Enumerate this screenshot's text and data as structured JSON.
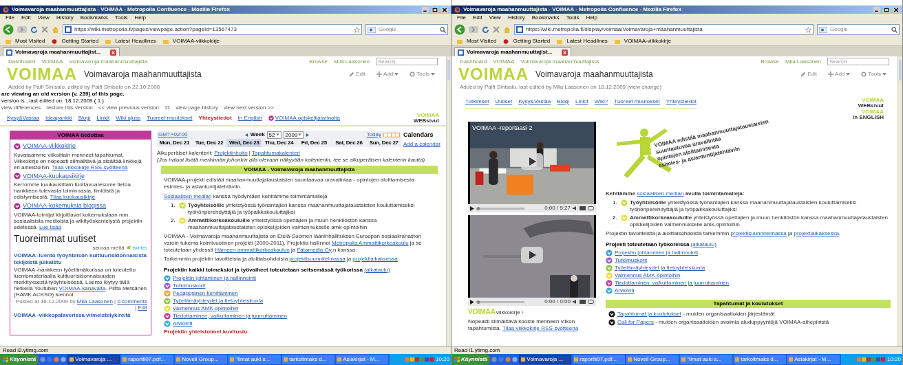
{
  "windows": [
    {
      "title": "Voimavaroja maahanmuuttajista - VOIMAA - Metropolia Confluence - Mozilla Firefox",
      "menu": [
        "File",
        "Edit",
        "View",
        "History",
        "Bookmarks",
        "Tools",
        "Help"
      ],
      "url": "https://wiki.metropolia.fi/pages/viewpage.action?pageId=13567473",
      "search_placeholder": "Google",
      "bookmarks": [
        "Most Visited",
        "Getting Started",
        "Latest Headlines",
        "VOIMAA-viikkokirje"
      ],
      "tab": "Voimavaroja maahanmuuttajist...",
      "breadcrumbs": [
        "Dashboard",
        "VOIMAA",
        "Voimavaroja maahanmuuttajista"
      ],
      "user_links": [
        "Browse",
        "Mila Laasonen"
      ],
      "site_search_placeholder": "Search",
      "logo": "VOIMAA",
      "page_title": "Voimavaroja maahanmuuttajista",
      "actions": [
        "Edit",
        "Add",
        "Tools"
      ],
      "byline": "Added by Paifi Sinisalo, edited by Paifi Sinisalo on 22.10.2008",
      "page": {
        "kind": "calendar_view",
        "version_notice": {
          "heading": "are viewing an old version (v. 259) of this page.",
          "detail": "version is , last edited on: 18.12.2009 ( 1 )",
          "links": [
            "view differences",
            "restore this version",
            "<< view previous version",
            "11",
            "view page history",
            "view next version >>"
          ]
        },
        "nav": [
          {
            "label": "Kysy&Vastaa",
            "selected": false
          },
          {
            "label": "Ideapankki",
            "selected": false
          },
          {
            "label": "Blogi",
            "selected": false
          },
          {
            "label": "Linkit",
            "selected": false
          },
          {
            "label": "Wiki ajuss",
            "selected": false
          },
          {
            "label": "Tuoreet muutokset",
            "selected": false
          },
          {
            "label": "Yhteystiedot",
            "selected": true
          },
          {
            "label": "In English",
            "selected": false
          },
          {
            "label": "VOIMAA opiskelijatarinoita",
            "selected": false,
            "color": "#b02a8a"
          }
        ],
        "corner_logos": [
          [
            "VOIMAA",
            "WEBsivut"
          ]
        ],
        "sidebar": {
          "title": "VOIMAA tiedottaa",
          "items": [
            {
              "title": "VOIMAA-viikkokirje",
              "color": "#b02a8a",
              "text": [
                {
                  "kind": "text",
                  "text": "Kuvataamme viikoittain menneet tapahtumat. Viikkokirje on nopeasti silmäiltävä ja sisältää linkkejä eri aineistoihin. "
                },
                {
                  "kind": "link",
                  "text": "Tilaa viikkokirje RSS-syötteenä"
                }
              ]
            },
            {
              "title": "VOIMAA-kuukausikirje",
              "color": "#b02a8a",
              "text": [
                {
                  "kind": "text",
                  "text": "Kerromme kuukausittain tuottavuaresome tietoa hankkeen tulevasta toiminnasta, ilmiöistä ja edistymisestä. "
                },
                {
                  "kind": "link",
                  "text": "Tilaa kuukausikirje"
                }
              ]
            },
            {
              "title": "VOIMAA-kokemuksia blogissa",
              "color": "#b02a8a",
              "text": [
                {
                  "kind": "text",
                  "text": "VOIMAA-toimijat kirjoittavat kokemuksiaan mm. sosiaalisista medioista ja wikityöskentelystä projektin edetessä. "
                },
                {
                  "kind": "link",
                  "text": "Lue lisää"
                }
              ]
            }
          ]
        },
        "news": {
          "heading": "Tuoreimmat uutiset",
          "follow": "seuraa meitä",
          "twitter": "twitter",
          "items": [
            {
              "title": "VOIMAA -luento työyhteisön kulttuurisidonnaisista tekijöistä julkaistu",
              "text": [
                {
                  "kind": "text",
                  "text": "VOIMAA -hankkeen työelämäkorissa on toteutettu luentomateriaalia kulttuurisidonnaisuuden merkityksestä työyhteisössä. Luento löytyy tällä hetkellä Youtuben "
                },
                {
                  "kind": "link",
                  "text": "VOIMAA-kanavalta"
                },
                {
                  "kind": "text",
                  "text": ". Piitta Metsänen (HAMK ACKSO) luennoi."
                }
              ],
              "meta": [
                {
                  "kind": "text",
                  "text": "Posted at 16.12.2009 by "
                },
                {
                  "kind": "link",
                  "text": "Mila Laasonen"
                },
                {
                  "kind": "text",
                  "text": " | "
                },
                {
                  "kind": "link",
                  "text": "0 comments"
                },
                {
                  "kind": "text",
                  "text": " | "
                },
                {
                  "kind": "link",
                  "text": "Edit"
                }
              ]
            },
            {
              "title": "VOIMAA -viikkopalaverissa viimeistelykireitä"
            }
          ]
        },
        "calendar": {
          "timezone": "GMT+02:00",
          "week_label": "Week",
          "week": "52",
          "year": "2009",
          "today": "Today",
          "days": [
            {
              "label": "Mon, Dec 21",
              "selected": false
            },
            {
              "label": "Tue, Dec 22",
              "selected": false
            },
            {
              "label": "Wed, Dec 23",
              "selected": true
            },
            {
              "label": "Thu, Dec 24",
              "selected": false
            },
            {
              "label": "Fri, Dec 25",
              "selected": false
            },
            {
              "label": "Sat, Dec 26",
              "selected": false
            },
            {
              "label": "Sun, Dec 27",
              "selected": false
            }
          ],
          "side_title": "Calendars",
          "add": "Add a calendar",
          "origins": [
            {
              "kind": "text",
              "text": "Alkuperäiset kalenterit: "
            },
            {
              "kind": "link",
              "text": "Projektinhoito"
            },
            {
              "kind": "text",
              "text": " | "
            },
            {
              "kind": "link",
              "text": "Tapahtumakalenteri"
            }
          ],
          "note": "(Jos haluat lisätä merkinnän johonkin alla olevaan näkyvään kalenteriin, tee se alkuperäisen kalenterin kautta)"
        },
        "content": {
          "banner": "VOIMAA - Voimavaroja maahanmuuttajista",
          "paragraphs_before": [
            [
              {
                "kind": "text",
                "text": "VOIMAA-projekti edistää maahanmuuttajataustaisten suuntaavaa uravalintaa - opintojen aloittamisesta esimies- ja asiantuntijatehtäviin."
              }
            ],
            [
              {
                "kind": "link",
                "text": "Sosiaalisen median"
              },
              {
                "kind": "text",
                "text": " kanssa hyödyntäen kehitämme toimintamalleja"
              }
            ]
          ],
          "steps": [
            {
              "number": "1.",
              "color": "#c8dc3c",
              "text": [
                {
                  "kind": "bold",
                  "text": "Työyhteisöille"
                },
                {
                  "kind": "text",
                  "text": " yhteistyössä työnantajien kanssa maahanmuuttajataustaisten kouluttamiseksi työhönperehdyttäjiä ja työpaikkakouluttajiksi"
                }
              ]
            },
            {
              "number": "2.",
              "color": "#e6e23a",
              "text": [
                {
                  "kind": "bold",
                  "text": "Ammattikorkeakouluille"
                },
                {
                  "kind": "text",
                  "text": " yhteistyössä opettajien ja muun henkilöstön kanssa maahanmuuttajataustaisten opiskelijoiden valmennukselle amk-opintoihin"
                }
              ]
            }
          ],
          "paragraphs_after": [
            [
              {
                "kind": "text",
                "text": "VOIMAA - Voimavaroja maahanmuuttajista on Etelä-Suomen lääninhallituksen Euroopan sosiaalirahaston varoin tukema kolmivuotinen projekti (2009-2011). Projektia hallinnoi "
              },
              {
                "kind": "link",
                "text": "Metropolia Ammattikorkeakoulu"
              },
              {
                "kind": "text",
                "text": " ja se toteutetaan yhdessä "
              },
              {
                "kind": "link",
                "text": "Hämeen ammattikorkeakoulun"
              },
              {
                "kind": "text",
                "text": " ja "
              },
              {
                "kind": "link",
                "text": "Fatamedia Oy"
              },
              {
                "kind": "text",
                "text": ":n kanssa."
              }
            ],
            [
              {
                "kind": "text",
                "text": "Tarkemmin projektin tavoitteista ja aloittaisohdoista "
              },
              {
                "kind": "link",
                "text": "projektisuunnitelmassa"
              },
              {
                "kind": "text",
                "text": " ja "
              },
              {
                "kind": "link",
                "text": "projektiaikaksessa"
              },
              {
                "kind": "text",
                "text": "."
              }
            ]
          ],
          "work_heading": [
            {
              "kind": "bold",
              "text": "Projektin kaikki toimeksiot ja työvaiheet toteutetaan seitsemässä työkorissa "
            },
            {
              "kind": "link",
              "text": "(aikataulu)"
            }
          ],
          "baskets": [
            {
              "label": "Projektin johtaminen ja hallinnointi",
              "color": "#3aa0d8"
            },
            {
              "label": "Tutkimuskorit",
              "color": "#9a5ad0"
            },
            {
              "label": "Pedagoginen kehittäminen",
              "color": "#e8a23a"
            },
            {
              "label": "Työelämäyhteydet ja tietoyhteiskunta",
              "color": "#8cc63e"
            },
            {
              "label": "Valmennus AMK-opintoihin",
              "color": "#e6e23a"
            },
            {
              "label": "Tiedottaminen, vaikuttaminen ja juurruttaminen",
              "color": "#c03a9a"
            },
            {
              "label": "Arviointi",
              "color": "#3aaed0"
            }
          ],
          "footer_heading": "Projektin yhteistoimet kuvitustu"
        }
      },
      "status": "Read i2.ytimg.com",
      "taskbar": {
        "start": "Käynnistä",
        "tasks": [
          {
            "label": "Voimavaroja ...",
            "selected": true
          },
          {
            "label": "raportti07.pdf...",
            "selected": false
          },
          {
            "label": "Novell Group...",
            "selected": false
          },
          {
            "label": "\"Ilmat auki s...",
            "selected": false
          },
          {
            "label": "tarkoitmaks d...",
            "selected": false
          },
          {
            "label": "Asiakirjat - M...",
            "selected": false
          }
        ],
        "clock": "10:20"
      }
    },
    {
      "title": "Voimavaroja maahanmuuttajista - VOIMAA - Metropolia Confluence - Mozilla Firefox",
      "menu": [
        "File",
        "Edit",
        "View",
        "History",
        "Bookmarks",
        "Tools",
        "Help"
      ],
      "url": "https://wiki.metropolia.fi/display/voimaa/Voimavaroja+maahanmuuttajista",
      "search_placeholder": "Google",
      "bookmarks": [
        "Most Visited",
        "Getting Started",
        "Latest Headlines",
        "VOIMAA-viikkokirje"
      ],
      "tab": "Voimavaroja maahanmuuttajist...",
      "breadcrumbs": [
        "Dashboard",
        "VOIMAA",
        "Voimavaroja maahanmuuttajista"
      ],
      "user_links": [
        "Browse",
        "Mila Laasonen"
      ],
      "site_search_placeholder": "Search",
      "logo": "VOIMAA",
      "page_title": "Voimavaroja maahanmuuttajista",
      "actions": [
        "Edit",
        "Add",
        "Tools"
      ],
      "byline": "Added by Paifi Sinisalo, last edited by Mila Laasonen on 18.12.2009 (view change)",
      "page": {
        "kind": "home_view",
        "nav": [
          {
            "label": "Tutkimset",
            "selected": false
          },
          {
            "label": "Uutiset",
            "selected": false
          },
          {
            "label": "Kysy&Vastaa",
            "selected": false
          },
          {
            "label": "Blogi",
            "selected": false
          },
          {
            "label": "Linkit",
            "selected": false
          },
          {
            "label": "Wiki?",
            "selected": false
          },
          {
            "label": "Tuoreet muutokset",
            "selected": false
          },
          {
            "label": "Yhteystiedot",
            "selected": false
          }
        ],
        "corner_logos": [
          [
            "VOIMAA",
            "WEBsivut"
          ],
          [
            "VOIMAA",
            "in ENGLISH"
          ]
        ],
        "videos": [
          {
            "title": "VOIMAA -reportaasi 2",
            "time": "0:00 / 5:27"
          },
          {
            "time": "0:00 / 0:00"
          }
        ],
        "newsletter": {
          "logo": "VOIMAA",
          "label": "viikkokirje ›",
          "text": [
            {
              "kind": "text",
              "text": "Nopeasti silmäiltävä kooste menneen viikon tapahtumista. "
            },
            {
              "kind": "link",
              "text": "Tilaa viikkokirje RSS-syötteenä"
            }
          ]
        },
        "graphic_lines": [
          "VOIMAA edistää maahanmuuttajataustaisten",
          "suuntautuvaa uravalintaa",
          "opintojen aloittamisesta",
          "esimies- ja asiantuntijatehtäviin"
        ],
        "content": {
          "paragraphs_before": [
            [
              {
                "kind": "bold",
                "text": "Kehitämme "
              },
              {
                "kind": "link",
                "text": "sosiaalisen median"
              },
              {
                "kind": "bold",
                "text": " avulla toimintamalleja:"
              }
            ]
          ],
          "steps": [
            {
              "number": "1.",
              "color": "#c8dc3c",
              "text": [
                {
                  "kind": "bold",
                  "text": "Työyhteisöille"
                },
                {
                  "kind": "text",
                  "text": " yhteistyössä työnantajien kanssa maahanmuuttajataustaisten kouluttamiseksi työhönperehdyttäjiä ja työpaikkakouluttajiksi"
                }
              ]
            },
            {
              "number": "2.",
              "color": "#e6e23a",
              "text": [
                {
                  "kind": "bold",
                  "text": "Ammattikorkeakouluille"
                },
                {
                  "kind": "text",
                  "text": " yhteistyössä opettajien ja muun henkilöstön kanssa maahanmuuttajataustaisten opiskelijoiden valmennukselle amk-opintoihin"
                }
              ]
            }
          ],
          "paragraphs_after": [
            [
              {
                "kind": "text",
                "text": "Projektin tavoitteista ja aloittaisohdoista tarkemmin "
              },
              {
                "kind": "link",
                "text": "projektisuunnitelmassa"
              },
              {
                "kind": "text",
                "text": " ja "
              },
              {
                "kind": "link",
                "text": "projektiaikaksessa"
              },
              {
                "kind": "text",
                "text": "."
              }
            ]
          ],
          "work_heading": [
            {
              "kind": "bold",
              "text": "Projekti toteutetaan työkoreissa "
            },
            {
              "kind": "link",
              "text": "(aikataulu)"
            }
          ],
          "baskets": [
            {
              "label": "Projektin johtaminen ja hallinnointi",
              "color": "#3aa0d8"
            },
            {
              "label": "Tutkimuskorit",
              "color": "#9a5ad0"
            },
            {
              "label": "Työelämäyhteydet ja tietoyhteiskunta",
              "color": "#8cc63e"
            },
            {
              "label": "Valmennus AMK-opintoihin",
              "color": "#e6e23a"
            },
            {
              "label": "Tiedottaminen, vaikuttaminen ja juurruttaminen",
              "color": "#c03a9a"
            },
            {
              "label": "Arviointi",
              "color": "#3aaed0"
            }
          ],
          "banner2": "Tapahtumat ja koulutukset",
          "events": [
            [
              {
                "kind": "link",
                "text": "Tapahtumat ja koulutukset"
              },
              {
                "kind": "text",
                "text": " - muiden organisaatioiden järjestämät"
              }
            ],
            [
              {
                "kind": "link",
                "text": "Call for Papers"
              },
              {
                "kind": "text",
                "text": " - muiden organisaatioiden avoimia aluduppyyntöjä VOIMAA-aihepiiristä"
              }
            ]
          ]
        }
      },
      "status": "Read i1.ytimg.com",
      "taskbar": {
        "start": "Käynnistä",
        "tasks": [
          {
            "label": "Voimavaroja ...",
            "selected": true
          },
          {
            "label": "raportti07.pdf...",
            "selected": false
          },
          {
            "label": "Novell Group...",
            "selected": false
          },
          {
            "label": "\"Ilmat auki s...",
            "selected": false
          },
          {
            "label": "tarkoitmaks d...",
            "selected": false
          },
          {
            "label": "Asiakirjat - M...",
            "selected": false
          }
        ],
        "clock": "10:20"
      }
    }
  ]
}
